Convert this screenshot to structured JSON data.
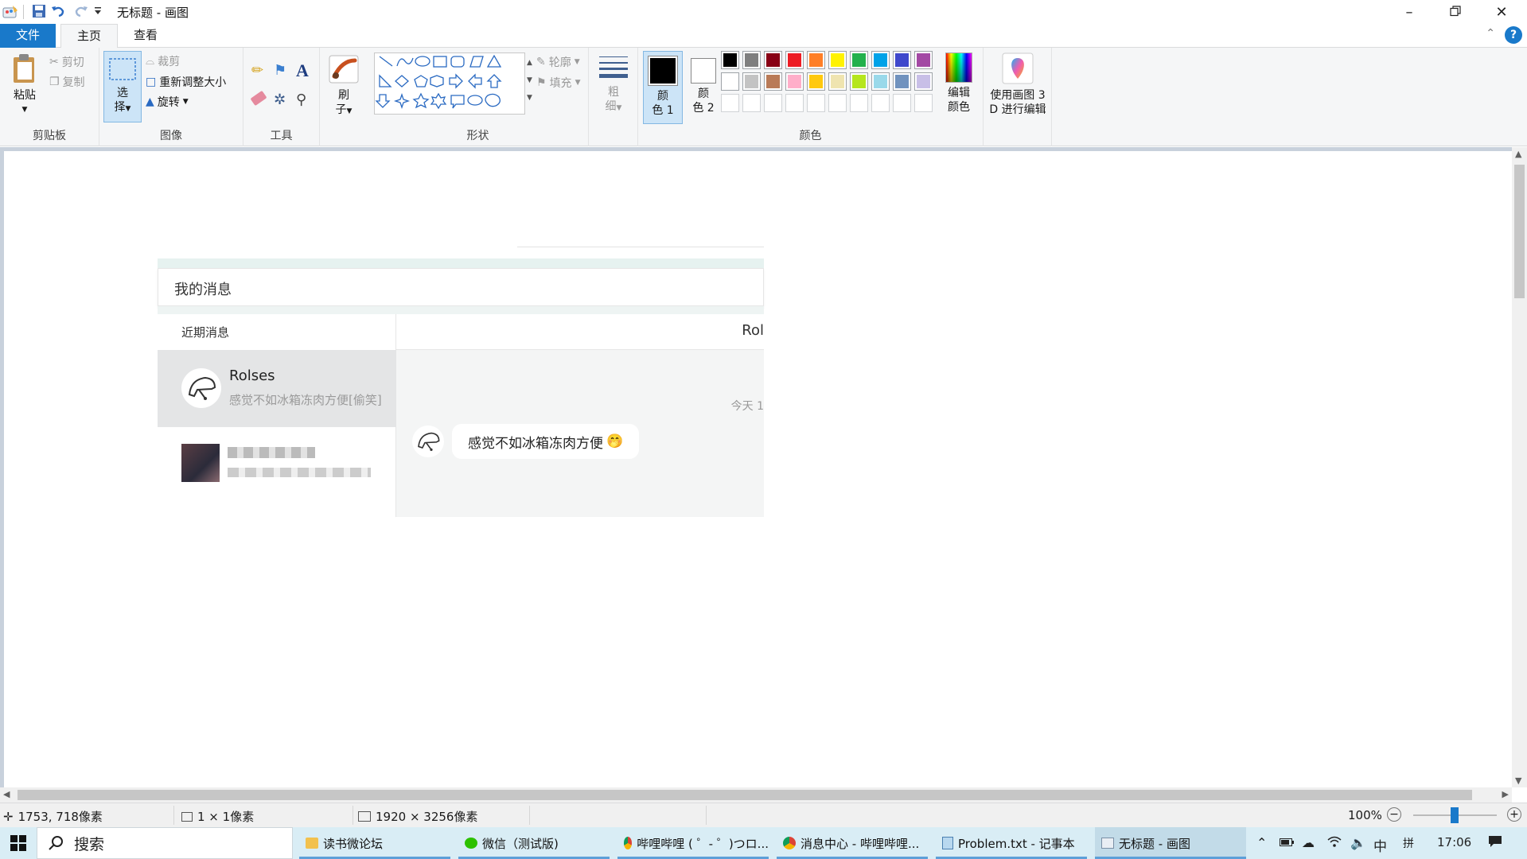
{
  "window": {
    "title": "无标题 - 画图",
    "minimize_icon": "minimize-icon",
    "restore_icon": "restore-icon",
    "close_icon": "close-icon"
  },
  "tabs": {
    "file": "文件",
    "home": "主页",
    "view": "查看"
  },
  "ribbon": {
    "clipboard": {
      "label": "剪贴板",
      "paste": "粘贴",
      "cut": "剪切",
      "copy": "复制"
    },
    "image": {
      "label": "图像",
      "select_1": "选",
      "select_2": "择",
      "crop": "裁剪",
      "resize": "重新调整大小",
      "rotate": "旋转"
    },
    "tools": {
      "label": "工具"
    },
    "brushes": {
      "line1": "刷",
      "line2": "子"
    },
    "shapes": {
      "label": "形状",
      "outline": "轮廓",
      "fill": "填充"
    },
    "size": {
      "line1": "粗",
      "line2": "细"
    },
    "colors": {
      "label": "颜色",
      "color1_line1": "颜",
      "color1_line2": "色 1",
      "color2_line1": "颜",
      "color2_line2": "色 2",
      "edit_line1": "编辑",
      "edit_line2": "颜色",
      "color1_value": "#000000",
      "color2_value": "#ffffff",
      "palette_row1": [
        "#000000",
        "#7f7f7f",
        "#880015",
        "#ed1c24",
        "#ff7f27",
        "#fff200",
        "#22b14c",
        "#00a2e8",
        "#3f48cc",
        "#a349a4"
      ],
      "palette_row2": [
        "#ffffff",
        "#c3c3c3",
        "#b97a57",
        "#ffaec9",
        "#ffc90e",
        "#efe4b0",
        "#b5e61d",
        "#99d9ea",
        "#7092be",
        "#c8bfe7"
      ],
      "palette_row3": [
        "#ffffff",
        "#ffffff",
        "#ffffff",
        "#ffffff",
        "#ffffff",
        "#ffffff",
        "#ffffff",
        "#ffffff",
        "#ffffff",
        "#ffffff"
      ]
    },
    "paint3d": {
      "line1": "使用画图 3",
      "line2": "D 进行编辑"
    }
  },
  "canvas_content": {
    "header": "我的消息",
    "sidebar_title": "近期消息",
    "chat_partner_header": "Rol",
    "contact_name": "Rolses",
    "contact_preview": "感觉不如冰箱冻肉方便[偷笑]",
    "time_label": "今天 1",
    "message_text": "感觉不如冰箱冻肉方便",
    "emoji": "🤭"
  },
  "statusbar": {
    "cursor_pos": "1753, 718像素",
    "selection_size": "1 × 1像素",
    "image_size": "1920 × 3256像素",
    "zoom": "100%"
  },
  "taskbar": {
    "search": "搜索",
    "tasks": [
      "读书微论坛",
      "微信（测试版)",
      "哔哩哔哩 ( ゜- ゜)つロ...",
      "消息中心 - 哔哩哔哩...",
      "Problem.txt - 记事本",
      "无标题 - 画图"
    ],
    "ime_lang": "中",
    "ime_mode": "拼",
    "clock": "17:06"
  }
}
